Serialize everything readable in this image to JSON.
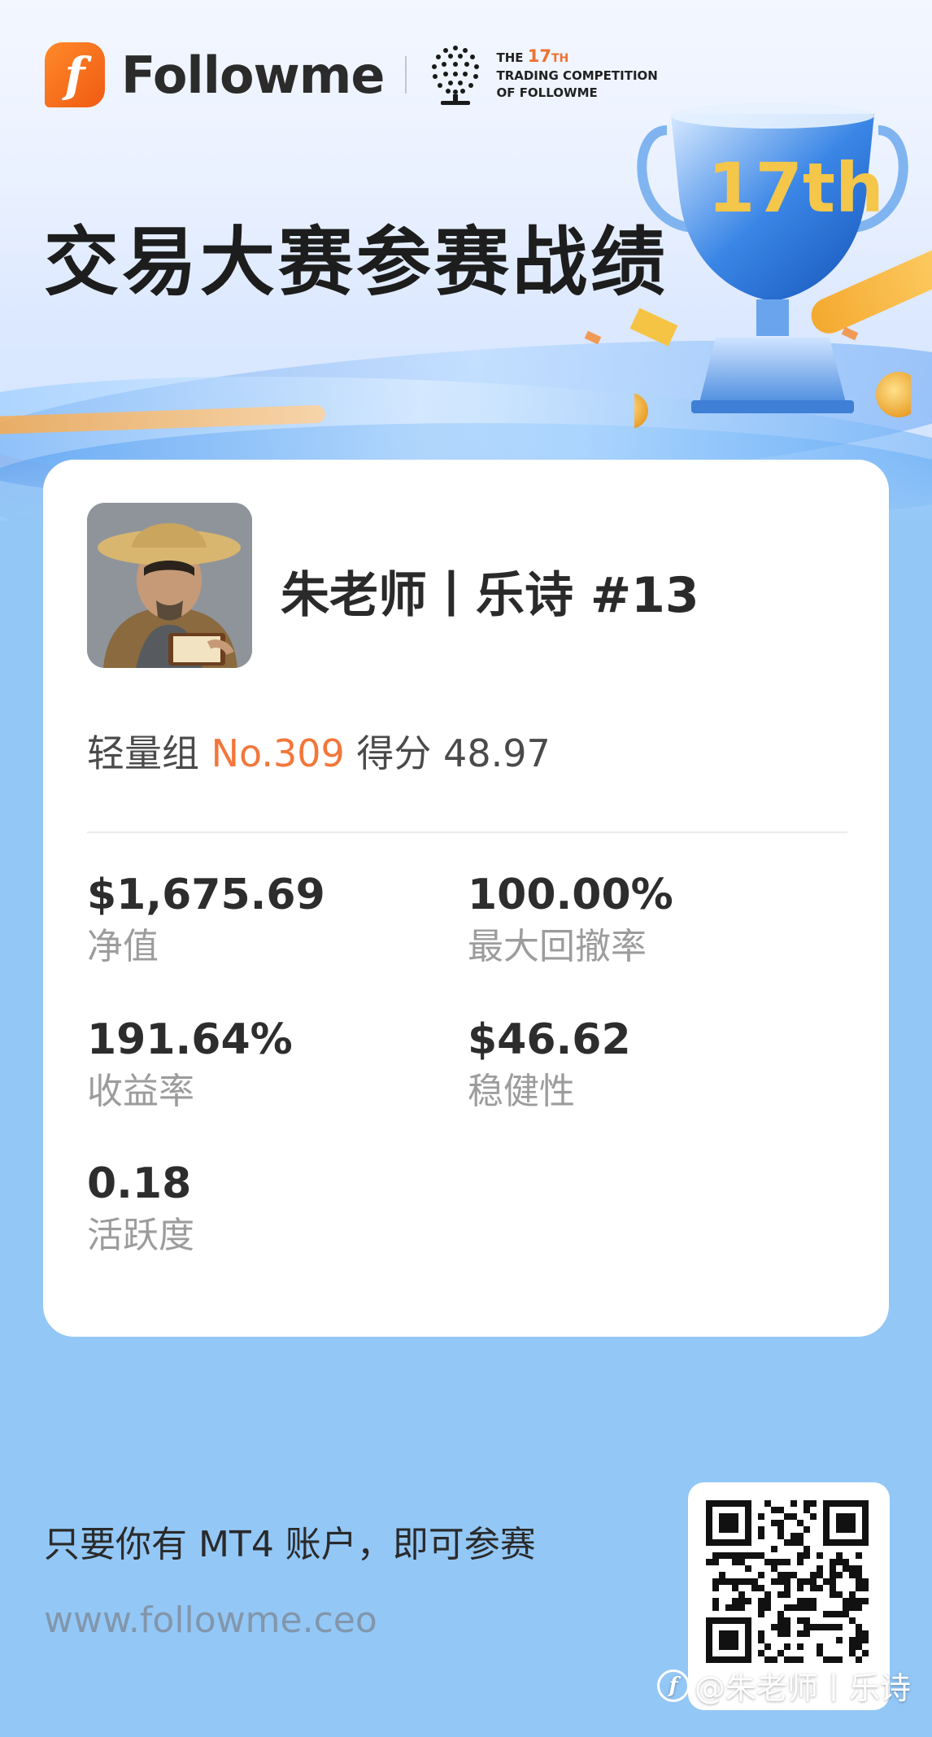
{
  "header": {
    "brand_name": "Followme",
    "logo_letter": "f",
    "competition": {
      "line1_prefix": "THE",
      "line1_num": "17",
      "line1_suffix": "TH",
      "line2": "TRADING COMPETITION",
      "line3": "OF FOLLOWME"
    },
    "title": "交易大赛参赛战绩",
    "trophy_text": "17th"
  },
  "profile": {
    "name": "朱老师丨乐诗 #13",
    "group": "轻量组",
    "rank": "No.309",
    "score_label": "得分",
    "score": "48.97"
  },
  "stats": [
    {
      "value": "$1,675.69",
      "label": "净值"
    },
    {
      "value": "100.00%",
      "label": "最大回撤率"
    },
    {
      "value": "191.64%",
      "label": "收益率"
    },
    {
      "value": "$46.62",
      "label": "稳健性"
    },
    {
      "value": "0.18",
      "label": "活跃度"
    }
  ],
  "footer": {
    "tagline": "只要你有 MT4 账户，即可参赛",
    "url": "www.followme.ceo",
    "watermark": "@朱老师丨乐诗",
    "watermark_logo": "f"
  },
  "colors": {
    "accent": "#f2773a",
    "background": "#93c7f6",
    "card": "#ffffff"
  }
}
